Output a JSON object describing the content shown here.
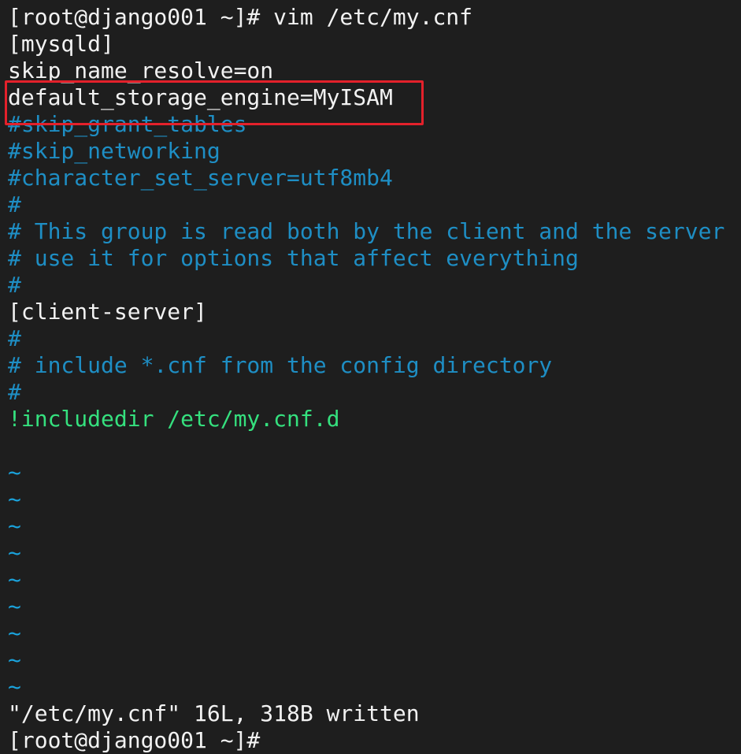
{
  "terminal": {
    "lines": [
      {
        "text": "[root@django001 ~]# vim /etc/my.cnf",
        "kind": "normal"
      },
      {
        "text": "[mysqld]",
        "kind": "normal"
      },
      {
        "text": "skip_name_resolve=on",
        "kind": "normal"
      },
      {
        "text": "default_storage_engine=MyISAM",
        "kind": "normal"
      },
      {
        "text": "#skip_grant_tables",
        "kind": "comment"
      },
      {
        "text": "#skip_networking",
        "kind": "comment"
      },
      {
        "text": "#character_set_server=utf8mb4",
        "kind": "comment"
      },
      {
        "text": "#",
        "kind": "comment"
      },
      {
        "text": "# This group is read both by the client and the server",
        "kind": "comment"
      },
      {
        "text": "# use it for options that affect everything",
        "kind": "comment"
      },
      {
        "text": "#",
        "kind": "comment"
      },
      {
        "text": "[client-server]",
        "kind": "normal"
      },
      {
        "text": "#",
        "kind": "comment"
      },
      {
        "text": "# include *.cnf from the config directory",
        "kind": "comment"
      },
      {
        "text": "#",
        "kind": "comment"
      },
      {
        "text": "!includedir /etc/my.cnf.d",
        "kind": "special"
      },
      {
        "text": "",
        "kind": "normal"
      },
      {
        "text": "~",
        "kind": "tilde"
      },
      {
        "text": "~",
        "kind": "tilde"
      },
      {
        "text": "~",
        "kind": "tilde"
      },
      {
        "text": "~",
        "kind": "tilde"
      },
      {
        "text": "~",
        "kind": "tilde"
      },
      {
        "text": "~",
        "kind": "tilde"
      },
      {
        "text": "~",
        "kind": "tilde"
      },
      {
        "text": "~",
        "kind": "tilde"
      },
      {
        "text": "~",
        "kind": "tilde"
      },
      {
        "text": "\"/etc/my.cnf\" 16L, 318B written",
        "kind": "normal"
      },
      {
        "text": "[root@django001 ~]#",
        "kind": "normal"
      }
    ],
    "highlighted_line": 3
  },
  "colors": {
    "background": "#1e1e1e",
    "text": "#f2f2f2",
    "comment": "#1e8ec4",
    "special": "#35e07e",
    "tilde": "#1aa3dc",
    "highlight_box": "#e3212b"
  }
}
